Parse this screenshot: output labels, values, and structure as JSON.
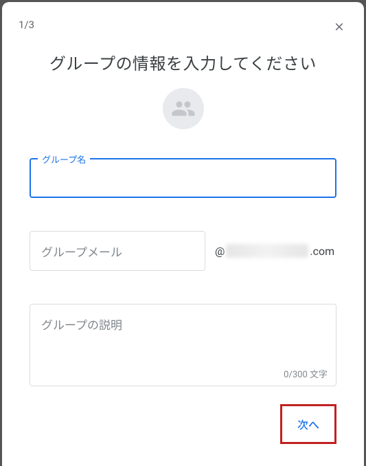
{
  "header": {
    "step": "1/3"
  },
  "title": "グループの情報を入力してください",
  "fields": {
    "name": {
      "label": "グループ名",
      "value": ""
    },
    "email": {
      "placeholder": "グループメール",
      "domain_prefix": "@",
      "domain_suffix": ".com"
    },
    "description": {
      "placeholder": "グループの説明",
      "counter": "0/300 文字"
    }
  },
  "footer": {
    "next_label": "次へ"
  }
}
